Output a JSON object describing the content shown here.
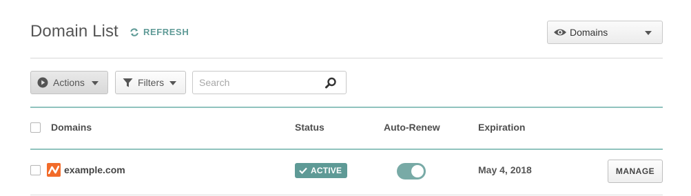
{
  "header": {
    "title": "Domain List",
    "refresh_label": "REFRESH",
    "view_select": {
      "selected": "Domains",
      "icon": "eye-icon"
    }
  },
  "toolbar": {
    "actions_label": "Actions",
    "filters_label": "Filters",
    "search": {
      "placeholder": "Search",
      "value": ""
    }
  },
  "table": {
    "columns": [
      "Domains",
      "Status",
      "Auto-Renew",
      "Expiration"
    ],
    "rows": [
      {
        "domain": "example.com",
        "status": "ACTIVE",
        "auto_renew": true,
        "expiration": "May 4, 2018",
        "action_label": "MANAGE"
      }
    ]
  },
  "colors": {
    "accent": "#5e9a96",
    "divider_teal": "#8fc2bd",
    "favicon": "#f26b2a",
    "toggle_on": "#78aaa6"
  }
}
